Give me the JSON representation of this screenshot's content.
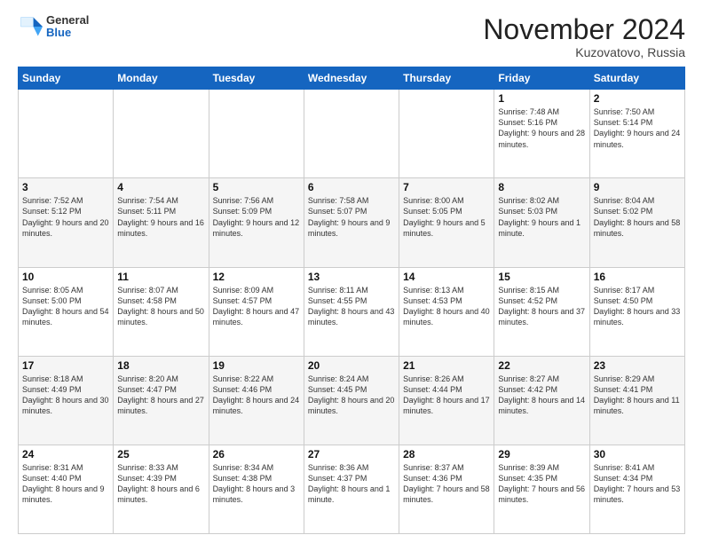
{
  "header": {
    "logo_general": "General",
    "logo_blue": "Blue",
    "month_title": "November 2024",
    "location": "Kuzovatovo, Russia"
  },
  "days_of_week": [
    "Sunday",
    "Monday",
    "Tuesday",
    "Wednesday",
    "Thursday",
    "Friday",
    "Saturday"
  ],
  "weeks": [
    [
      {
        "day": "",
        "info": ""
      },
      {
        "day": "",
        "info": ""
      },
      {
        "day": "",
        "info": ""
      },
      {
        "day": "",
        "info": ""
      },
      {
        "day": "",
        "info": ""
      },
      {
        "day": "1",
        "info": "Sunrise: 7:48 AM\nSunset: 5:16 PM\nDaylight: 9 hours\nand 28 minutes."
      },
      {
        "day": "2",
        "info": "Sunrise: 7:50 AM\nSunset: 5:14 PM\nDaylight: 9 hours\nand 24 minutes."
      }
    ],
    [
      {
        "day": "3",
        "info": "Sunrise: 7:52 AM\nSunset: 5:12 PM\nDaylight: 9 hours\nand 20 minutes."
      },
      {
        "day": "4",
        "info": "Sunrise: 7:54 AM\nSunset: 5:11 PM\nDaylight: 9 hours\nand 16 minutes."
      },
      {
        "day": "5",
        "info": "Sunrise: 7:56 AM\nSunset: 5:09 PM\nDaylight: 9 hours\nand 12 minutes."
      },
      {
        "day": "6",
        "info": "Sunrise: 7:58 AM\nSunset: 5:07 PM\nDaylight: 9 hours\nand 9 minutes."
      },
      {
        "day": "7",
        "info": "Sunrise: 8:00 AM\nSunset: 5:05 PM\nDaylight: 9 hours\nand 5 minutes."
      },
      {
        "day": "8",
        "info": "Sunrise: 8:02 AM\nSunset: 5:03 PM\nDaylight: 9 hours\nand 1 minute."
      },
      {
        "day": "9",
        "info": "Sunrise: 8:04 AM\nSunset: 5:02 PM\nDaylight: 8 hours\nand 58 minutes."
      }
    ],
    [
      {
        "day": "10",
        "info": "Sunrise: 8:05 AM\nSunset: 5:00 PM\nDaylight: 8 hours\nand 54 minutes."
      },
      {
        "day": "11",
        "info": "Sunrise: 8:07 AM\nSunset: 4:58 PM\nDaylight: 8 hours\nand 50 minutes."
      },
      {
        "day": "12",
        "info": "Sunrise: 8:09 AM\nSunset: 4:57 PM\nDaylight: 8 hours\nand 47 minutes."
      },
      {
        "day": "13",
        "info": "Sunrise: 8:11 AM\nSunset: 4:55 PM\nDaylight: 8 hours\nand 43 minutes."
      },
      {
        "day": "14",
        "info": "Sunrise: 8:13 AM\nSunset: 4:53 PM\nDaylight: 8 hours\nand 40 minutes."
      },
      {
        "day": "15",
        "info": "Sunrise: 8:15 AM\nSunset: 4:52 PM\nDaylight: 8 hours\nand 37 minutes."
      },
      {
        "day": "16",
        "info": "Sunrise: 8:17 AM\nSunset: 4:50 PM\nDaylight: 8 hours\nand 33 minutes."
      }
    ],
    [
      {
        "day": "17",
        "info": "Sunrise: 8:18 AM\nSunset: 4:49 PM\nDaylight: 8 hours\nand 30 minutes."
      },
      {
        "day": "18",
        "info": "Sunrise: 8:20 AM\nSunset: 4:47 PM\nDaylight: 8 hours\nand 27 minutes."
      },
      {
        "day": "19",
        "info": "Sunrise: 8:22 AM\nSunset: 4:46 PM\nDaylight: 8 hours\nand 24 minutes."
      },
      {
        "day": "20",
        "info": "Sunrise: 8:24 AM\nSunset: 4:45 PM\nDaylight: 8 hours\nand 20 minutes."
      },
      {
        "day": "21",
        "info": "Sunrise: 8:26 AM\nSunset: 4:44 PM\nDaylight: 8 hours\nand 17 minutes."
      },
      {
        "day": "22",
        "info": "Sunrise: 8:27 AM\nSunset: 4:42 PM\nDaylight: 8 hours\nand 14 minutes."
      },
      {
        "day": "23",
        "info": "Sunrise: 8:29 AM\nSunset: 4:41 PM\nDaylight: 8 hours\nand 11 minutes."
      }
    ],
    [
      {
        "day": "24",
        "info": "Sunrise: 8:31 AM\nSunset: 4:40 PM\nDaylight: 8 hours\nand 9 minutes."
      },
      {
        "day": "25",
        "info": "Sunrise: 8:33 AM\nSunset: 4:39 PM\nDaylight: 8 hours\nand 6 minutes."
      },
      {
        "day": "26",
        "info": "Sunrise: 8:34 AM\nSunset: 4:38 PM\nDaylight: 8 hours\nand 3 minutes."
      },
      {
        "day": "27",
        "info": "Sunrise: 8:36 AM\nSunset: 4:37 PM\nDaylight: 8 hours\nand 1 minute."
      },
      {
        "day": "28",
        "info": "Sunrise: 8:37 AM\nSunset: 4:36 PM\nDaylight: 7 hours\nand 58 minutes."
      },
      {
        "day": "29",
        "info": "Sunrise: 8:39 AM\nSunset: 4:35 PM\nDaylight: 7 hours\nand 56 minutes."
      },
      {
        "day": "30",
        "info": "Sunrise: 8:41 AM\nSunset: 4:34 PM\nDaylight: 7 hours\nand 53 minutes."
      }
    ]
  ]
}
